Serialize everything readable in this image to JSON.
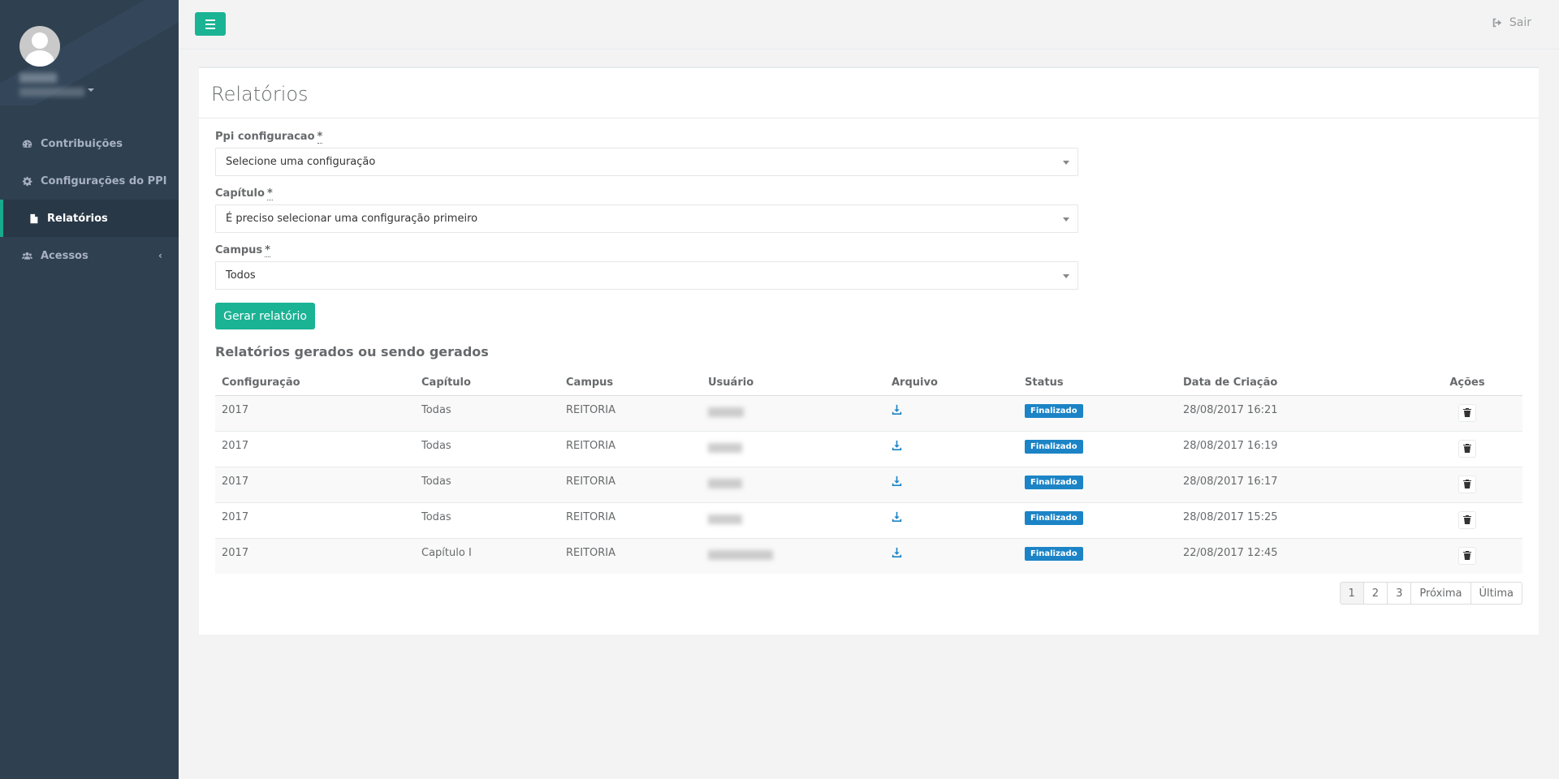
{
  "sidebar": {
    "items": [
      {
        "label": "Contribuições",
        "icon": "dashboard-icon"
      },
      {
        "label": "Configurações do PPI",
        "icon": "gear-icon"
      },
      {
        "label": "Relatórios",
        "icon": "file-icon",
        "active": true
      },
      {
        "label": "Acessos",
        "icon": "users-icon"
      }
    ]
  },
  "topbar": {
    "logout_label": "Sair"
  },
  "page": {
    "title": "Relatórios"
  },
  "form": {
    "config_label": "Ppi configuracao",
    "config_value": "Selecione uma configuração",
    "chapter_label": "Capítulo",
    "chapter_value": "É preciso selecionar uma configuração primeiro",
    "campus_label": "Campus",
    "campus_value": "Todos",
    "required_marker": "*",
    "submit_label": "Gerar relatório"
  },
  "reports": {
    "heading": "Relatórios gerados ou sendo gerados",
    "columns": [
      "Configuração",
      "Capítulo",
      "Campus",
      "Usuário",
      "Arquivo",
      "Status",
      "Data de Criação",
      "Ações"
    ],
    "rows": [
      {
        "config": "2017",
        "chapter": "Todas",
        "campus": "REITORIA",
        "status": "Finalizado",
        "date": "28/08/2017 16:21"
      },
      {
        "config": "2017",
        "chapter": "Todas",
        "campus": "REITORIA",
        "status": "Finalizado",
        "date": "28/08/2017 16:19"
      },
      {
        "config": "2017",
        "chapter": "Todas",
        "campus": "REITORIA",
        "status": "Finalizado",
        "date": "28/08/2017 16:17"
      },
      {
        "config": "2017",
        "chapter": "Todas",
        "campus": "REITORIA",
        "status": "Finalizado",
        "date": "28/08/2017 15:25"
      },
      {
        "config": "2017",
        "chapter": "Capítulo I",
        "campus": "REITORIA",
        "status": "Finalizado",
        "date": "22/08/2017 12:45"
      }
    ]
  },
  "pagination": {
    "pages": [
      "1",
      "2",
      "3"
    ],
    "next_label": "Próxima",
    "last_label": "Última",
    "current": "1"
  },
  "colors": {
    "sidebar_bg": "#2f4050",
    "accent": "#1ab394",
    "badge": "#1c84c6"
  }
}
